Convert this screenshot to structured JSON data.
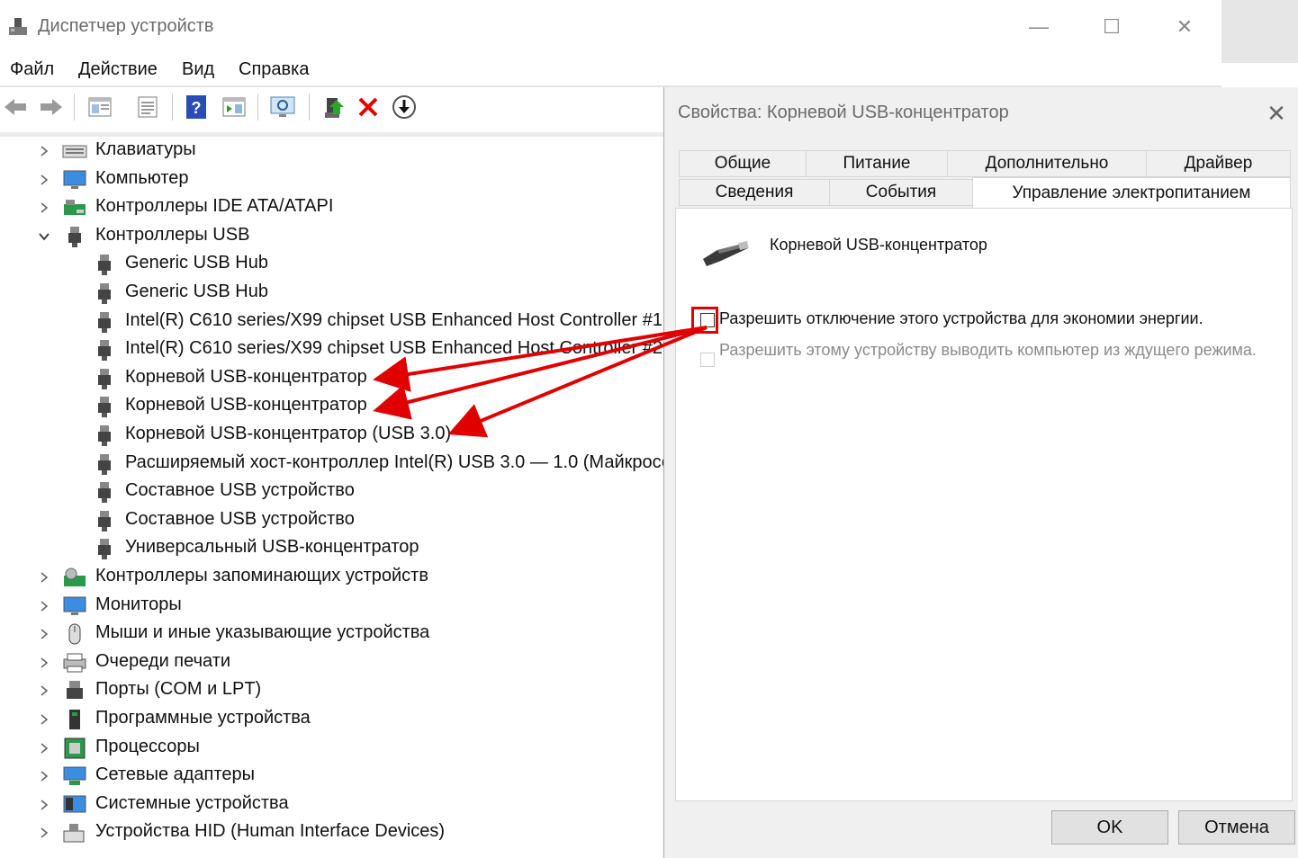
{
  "main_window": {
    "title": "Диспетчер устройств",
    "minimize": "—",
    "maximize": "☐",
    "close": "✕",
    "menu": [
      {
        "label": "Файл"
      },
      {
        "label": "Действие"
      },
      {
        "label": "Вид"
      },
      {
        "label": "Справка"
      }
    ],
    "toolbar": [
      {
        "name": "back-icon"
      },
      {
        "name": "forward-icon"
      },
      {
        "name": "show-hide-tree-icon"
      },
      {
        "name": "properties-icon"
      },
      {
        "name": "help-icon"
      },
      {
        "name": "action-pane-icon"
      },
      {
        "name": "scan-hardware-icon"
      },
      {
        "name": "update-driver-icon"
      },
      {
        "name": "uninstall-icon"
      },
      {
        "name": "disable-device-icon"
      }
    ]
  },
  "tree": {
    "items": [
      {
        "label": "Клавиатуры",
        "level": 0,
        "expanded": false,
        "icon": "keyboard-icon"
      },
      {
        "label": "Компьютер",
        "level": 0,
        "expanded": false,
        "icon": "computer-icon"
      },
      {
        "label": "Контроллеры IDE ATA/ATAPI",
        "level": 0,
        "expanded": false,
        "icon": "ide-controller-icon"
      },
      {
        "label": "Контроллеры USB",
        "level": 0,
        "expanded": true,
        "icon": "usb-icon"
      },
      {
        "label": "Generic USB Hub",
        "level": 1,
        "icon": "usb-icon"
      },
      {
        "label": "Generic USB Hub",
        "level": 1,
        "icon": "usb-icon"
      },
      {
        "label": "Intel(R) C610 series/X99 chipset USB Enhanced Host Controller #1 -",
        "level": 1,
        "icon": "usb-icon"
      },
      {
        "label": "Intel(R) C610 series/X99 chipset USB Enhanced Host Controller #2",
        "level": 1,
        "icon": "usb-icon"
      },
      {
        "label": "Корневой USB-концентратор",
        "level": 1,
        "icon": "usb-icon"
      },
      {
        "label": "Корневой USB-концентратор",
        "level": 1,
        "icon": "usb-icon"
      },
      {
        "label": "Корневой USB-концентратор (USB 3.0)",
        "level": 1,
        "icon": "usb-icon"
      },
      {
        "label": "Расширяемый хост-контроллер Intel(R) USB 3.0 — 1.0 (Майкросо",
        "level": 1,
        "icon": "usb-icon"
      },
      {
        "label": "Составное USB устройство",
        "level": 1,
        "icon": "usb-icon"
      },
      {
        "label": "Составное USB устройство",
        "level": 1,
        "icon": "usb-icon"
      },
      {
        "label": "Универсальный USB-концентратор",
        "level": 1,
        "icon": "usb-icon"
      },
      {
        "label": "Контроллеры запоминающих устройств",
        "level": 0,
        "expanded": false,
        "icon": "storage-controller-icon"
      },
      {
        "label": "Мониторы",
        "level": 0,
        "expanded": false,
        "icon": "monitor-icon"
      },
      {
        "label": "Мыши и иные указывающие устройства",
        "level": 0,
        "expanded": false,
        "icon": "mouse-icon"
      },
      {
        "label": "Очереди печати",
        "level": 0,
        "expanded": false,
        "icon": "printer-icon"
      },
      {
        "label": "Порты (COM и LPT)",
        "level": 0,
        "expanded": false,
        "icon": "port-icon"
      },
      {
        "label": "Программные устройства",
        "level": 0,
        "expanded": false,
        "icon": "software-device-icon"
      },
      {
        "label": "Процессоры",
        "level": 0,
        "expanded": false,
        "icon": "processor-icon"
      },
      {
        "label": "Сетевые адаптеры",
        "level": 0,
        "expanded": false,
        "icon": "network-adapter-icon"
      },
      {
        "label": "Системные устройства",
        "level": 0,
        "expanded": false,
        "icon": "system-device-icon"
      },
      {
        "label": "Устройства HID (Human Interface Devices)",
        "level": 0,
        "expanded": false,
        "icon": "hid-icon"
      }
    ]
  },
  "dialog": {
    "title": "Свойства: Корневой USB-концентратор",
    "close": "✕",
    "tabs_back": [
      {
        "label": "Общие"
      },
      {
        "label": "Питание"
      },
      {
        "label": "Дополнительно"
      },
      {
        "label": "Драйвер"
      }
    ],
    "tabs_front": [
      {
        "label": "Сведения"
      },
      {
        "label": "События"
      },
      {
        "label": "Управление электропитанием",
        "active": true
      }
    ],
    "device_name": "Корневой USB-концентратор",
    "checkbox_power_off": {
      "label": "Разрешить отключение этого устройства для экономии энергии.",
      "checked": false
    },
    "checkbox_wake": {
      "label": "Разрешить этому устройству выводить компьютер из ждущего режима.",
      "checked": false,
      "disabled": true
    },
    "ok_label": "OK",
    "cancel_label": "Отмена"
  },
  "colors": {
    "annotation": "#e00000",
    "window_bg": "#ffffff",
    "dialog_bg": "#f0f0f0"
  }
}
